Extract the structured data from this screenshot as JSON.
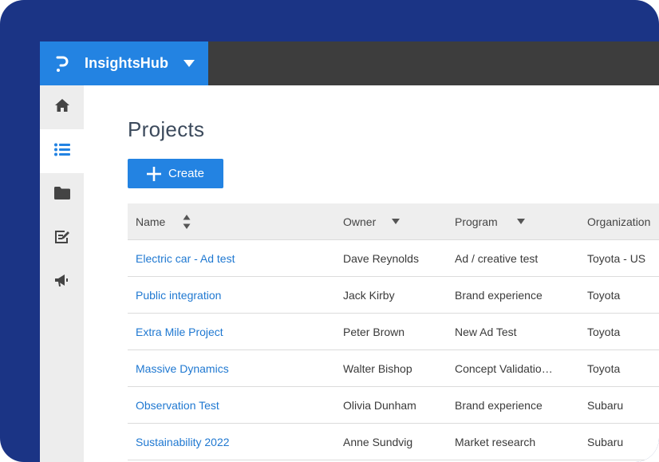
{
  "app": {
    "name": "InsightsHub",
    "brand_color": "#2383e2",
    "frame_color": "#1b3485",
    "logo_icon": "p-logo-icon",
    "switcher_icon": "caret-down-icon"
  },
  "sidebar": {
    "items": [
      {
        "name": "home",
        "icon": "home-icon",
        "active": false
      },
      {
        "name": "projects",
        "icon": "list-icon",
        "active": true
      },
      {
        "name": "folders",
        "icon": "folder-icon",
        "active": false
      },
      {
        "name": "edit",
        "icon": "edit-icon",
        "active": false
      },
      {
        "name": "announcements",
        "icon": "megaphone-icon",
        "active": false
      }
    ]
  },
  "page": {
    "title": "Projects",
    "create_label": "Create"
  },
  "table": {
    "headers": {
      "name": "Name",
      "owner": "Owner",
      "program": "Program",
      "organization": "Organization"
    },
    "rows": [
      {
        "name": "Electric car - Ad test",
        "owner": "Dave Reynolds",
        "program": "Ad / creative test",
        "organization": "Toyota - US"
      },
      {
        "name": "Public integration",
        "owner": "Jack Kirby",
        "program": "Brand experience",
        "organization": "Toyota"
      },
      {
        "name": "Extra Mile Project",
        "owner": "Peter Brown",
        "program": "New Ad Test",
        "organization": "Toyota"
      },
      {
        "name": "Massive Dynamics",
        "owner": "Walter Bishop",
        "program": "Concept Validatio…",
        "organization": "Toyota"
      },
      {
        "name": "Observation Test",
        "owner": "Olivia Dunham",
        "program": "Brand experience",
        "organization": "Subaru"
      },
      {
        "name": "Sustainability 2022",
        "owner": "Anne Sundvig",
        "program": "Market research",
        "organization": "Subaru"
      }
    ]
  }
}
